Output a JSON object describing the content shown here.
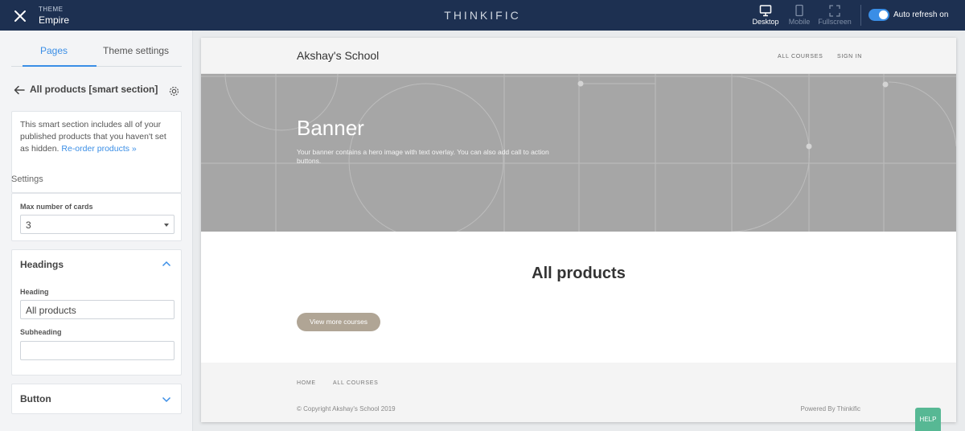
{
  "topbar": {
    "kicker": "THEME",
    "theme_name": "Empire",
    "brand": "THINKIFIC",
    "devices": {
      "desktop": "Desktop",
      "mobile": "Mobile",
      "fullscreen": "Fullscreen"
    },
    "auto_refresh_label": "Auto refresh on",
    "auto_refresh_on": true,
    "accent": "#3a8ee6",
    "bar_color": "#1d3051"
  },
  "sidebar": {
    "tabs": {
      "pages": "Pages",
      "theme_settings": "Theme settings"
    },
    "section_title": "All products [smart section]",
    "info_text": "This smart section includes all of your published products that you haven't set as hidden.",
    "info_link": "Re-order products »",
    "settings_label": "Settings",
    "max_cards_label": "Max number of cards",
    "max_cards_value": "3",
    "headings_title": "Headings",
    "heading_label": "Heading",
    "heading_value": "All products",
    "subheading_label": "Subheading",
    "subheading_value": "",
    "button_title": "Button"
  },
  "preview": {
    "school_name": "Akshay's School",
    "nav": {
      "all_courses": "ALL COURSES",
      "sign_in": "SIGN IN"
    },
    "banner_title": "Banner",
    "banner_text": "Your banner contains a hero image with text overlay. You can also add call to action buttons.",
    "products_title": "All products",
    "more_button": "View more courses",
    "footer": {
      "home": "HOME",
      "all_courses": "ALL COURSES",
      "copyright": "© Copyright Akshay's School 2019",
      "powered": "Powered By Thinkific"
    },
    "help": "HELP",
    "button_color": "#b0a595",
    "banner_color": "#a6a6a6"
  }
}
